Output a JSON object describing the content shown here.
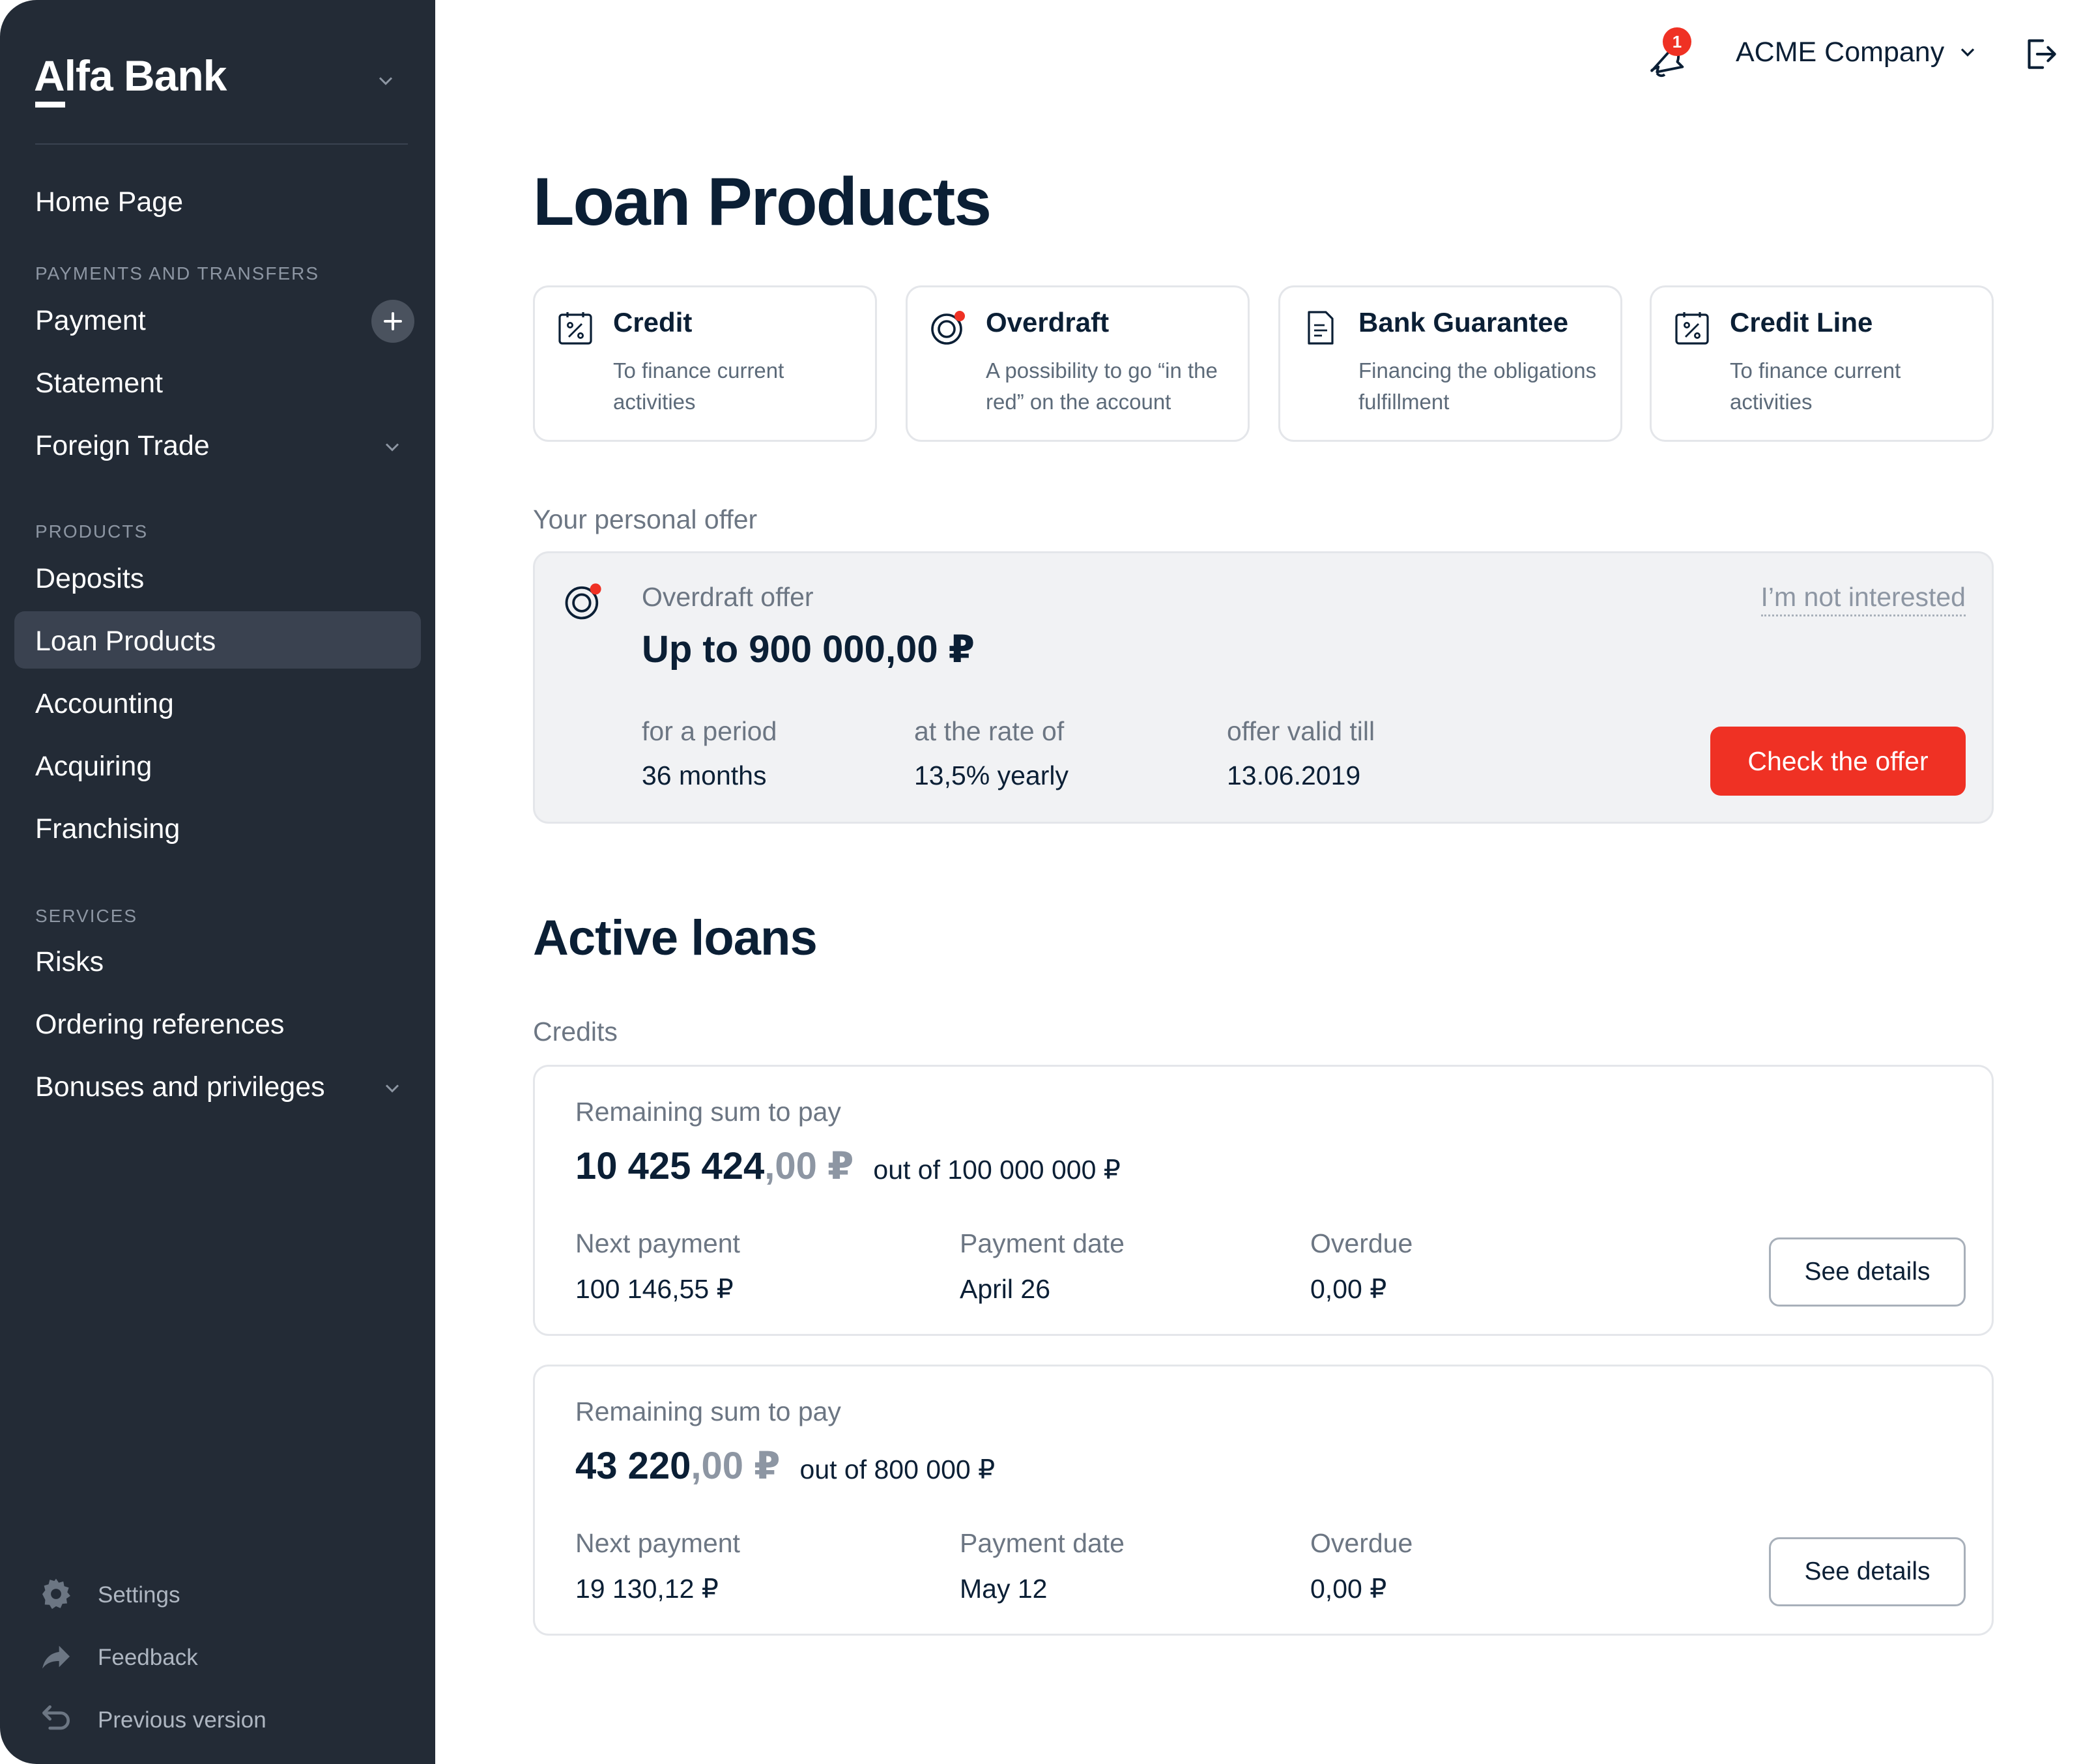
{
  "sidebar": {
    "logo": "Alfa Bank",
    "home": "Home Page",
    "section_payments": "PAYMENTS AND TRANSFERS",
    "payment": "Payment",
    "statement": "Statement",
    "foreign_trade": "Foreign Trade",
    "section_products": "PRODUCTS",
    "deposits": "Deposits",
    "loan_products": "Loan Products",
    "accounting": "Accounting",
    "acquiring": "Acquiring",
    "franchising": "Franchising",
    "section_services": "SERVICES",
    "risks": "Risks",
    "ordering_references": "Ordering references",
    "bonuses": "Bonuses and privileges",
    "settings": "Settings",
    "feedback": "Feedback",
    "previous_version": "Previous version",
    "active_item": "Loan Products"
  },
  "header": {
    "notification_count": "1",
    "company": "ACME Company"
  },
  "page_title": "Loan Products",
  "products": [
    {
      "title": "Credit",
      "desc": "To finance current activities",
      "icon": "percent-calendar-icon"
    },
    {
      "title": "Overdraft",
      "desc": "A possibility to go “in the red” on the account",
      "icon": "overdraft-icon"
    },
    {
      "title": "Bank Guarantee",
      "desc": "Financing the obligations fulfillment",
      "icon": "document-icon"
    },
    {
      "title": "Credit Line",
      "desc": "To finance current activities",
      "icon": "percent-calendar-icon"
    }
  ],
  "personal_offer": {
    "label": "Your personal offer",
    "kicker": "Overdraft offer",
    "amount": "Up to 900 000,00 ₽",
    "not_interested": "I’m not interested",
    "period_label": "for a period",
    "period_value": "36 months",
    "rate_label": "at the rate of",
    "rate_value": "13,5% yearly",
    "valid_label": "offer valid till",
    "valid_value": "13.06.2019",
    "cta": "Check the offer"
  },
  "active_loans": {
    "title": "Active loans",
    "subtitle": "Credits",
    "loans": [
      {
        "kicker": "Remaining sum to pay",
        "amount_whole": "10 425 424",
        "amount_cents": ",00 ₽",
        "out_of": "out of 100 000 000 ₽",
        "next_payment_label": "Next payment",
        "next_payment_value": "100 146,55 ₽",
        "payment_date_label": "Payment date",
        "payment_date_value": "April 26",
        "overdue_label": "Overdue",
        "overdue_value": "0,00 ₽",
        "button": "See details"
      },
      {
        "kicker": "Remaining sum to pay",
        "amount_whole": "43 220",
        "amount_cents": ",00 ₽",
        "out_of": "out of 800 000 ₽",
        "next_payment_label": "Next payment",
        "next_payment_value": "19 130,12 ₽",
        "payment_date_label": "Payment date",
        "payment_date_value": "May 12",
        "overdue_label": "Overdue",
        "overdue_value": "0,00 ₽",
        "button": "See details"
      }
    ]
  },
  "colors": {
    "sidebar_bg": "#232b36",
    "accent_red": "#ef3124",
    "text_dark": "#0b1f35",
    "text_muted": "#6c7683"
  }
}
